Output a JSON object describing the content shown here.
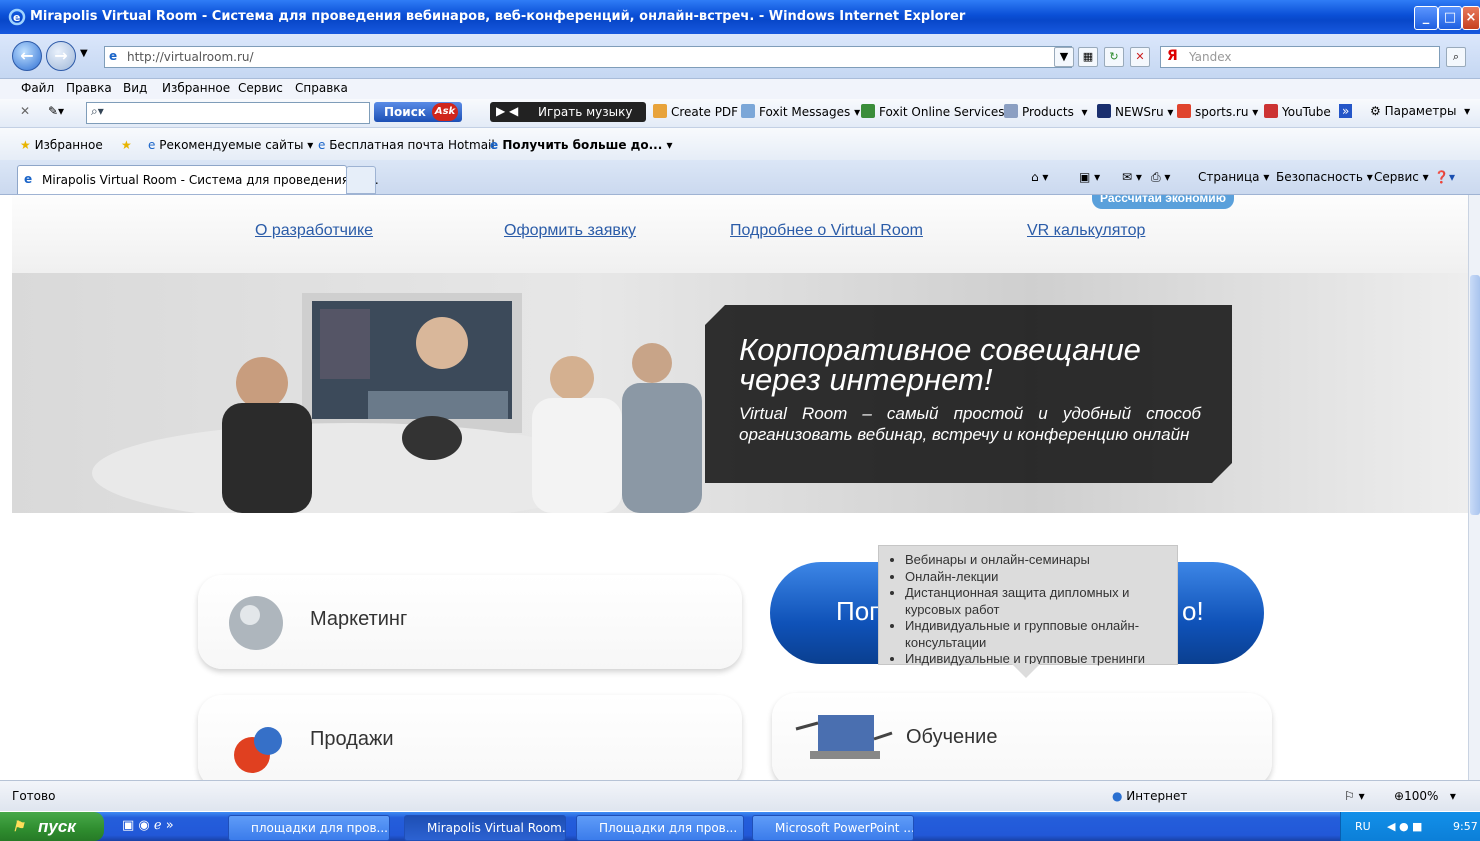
{
  "window": {
    "title": "Mirapolis Virtual Room - Система для проведения вебинаров, веб-конференций, онлайн-встреч. - Windows Internet Explorer"
  },
  "address": {
    "url": "http://virtualroom.ru/",
    "search_placeholder": "Yandex"
  },
  "menubar": [
    "Файл",
    "Правка",
    "Вид",
    "Избранное",
    "Сервис",
    "Справка"
  ],
  "toolbar": {
    "search_button": "Поиск",
    "ask_badge": "Ask",
    "music": "Играть музыку",
    "items": [
      "Create PDF",
      "Foxit Messages",
      "Foxit Online Services",
      "Products",
      "NEWSru",
      "sports.ru",
      "YouTube",
      "Параметры"
    ]
  },
  "favorites": {
    "label": "Избранное",
    "items": [
      "Рекомендуемые сайты",
      "Бесплатная почта Hotmail",
      "Получить больше до..."
    ]
  },
  "tab": {
    "title": "Mirapolis Virtual Room - Система для проведения ве..."
  },
  "commandbar": [
    "Страница",
    "Безопасность",
    "Сервис"
  ],
  "page": {
    "nav": [
      "О разработчике",
      "Оформить заявку",
      "Подробнее о Virtual Room",
      "VR калькулятор"
    ],
    "calc_badge": "Рассчитай экономию",
    "banner": {
      "title": "Корпоративное совещание через интернет!",
      "subtitle": "Virtual Room – самый простой и удобный способ организовать вебинар, встречу и конференцию онлайн"
    },
    "cards": {
      "marketing": "Маркетинг",
      "sales": "Продажи",
      "training": "Обучение"
    },
    "big_button": {
      "left": "Поп",
      "right": "о!"
    },
    "tooltip": [
      "Вебинары и онлайн-семинары",
      "Онлайн-лекции",
      "Дистанционная защита дипломных и курсовых работ",
      "Индивидуальные и групповые онлайн-консультации",
      "Индивидуальные и групповые тренинги"
    ]
  },
  "status": {
    "text": "Готово",
    "zone": "Интернет",
    "zoom": "100%"
  },
  "taskbar": {
    "start": "пуск",
    "buttons": [
      "площадки для пров...",
      "Mirapolis Virtual Room...",
      "Площадки для пров...",
      "Microsoft PowerPoint ..."
    ],
    "lang": "RU",
    "clock": "9:57"
  },
  "colors": {
    "link": "#2b5ca8",
    "title_bar": "#0a4fd6",
    "big_button": "#0f52b8",
    "card_bg": "#141414"
  }
}
